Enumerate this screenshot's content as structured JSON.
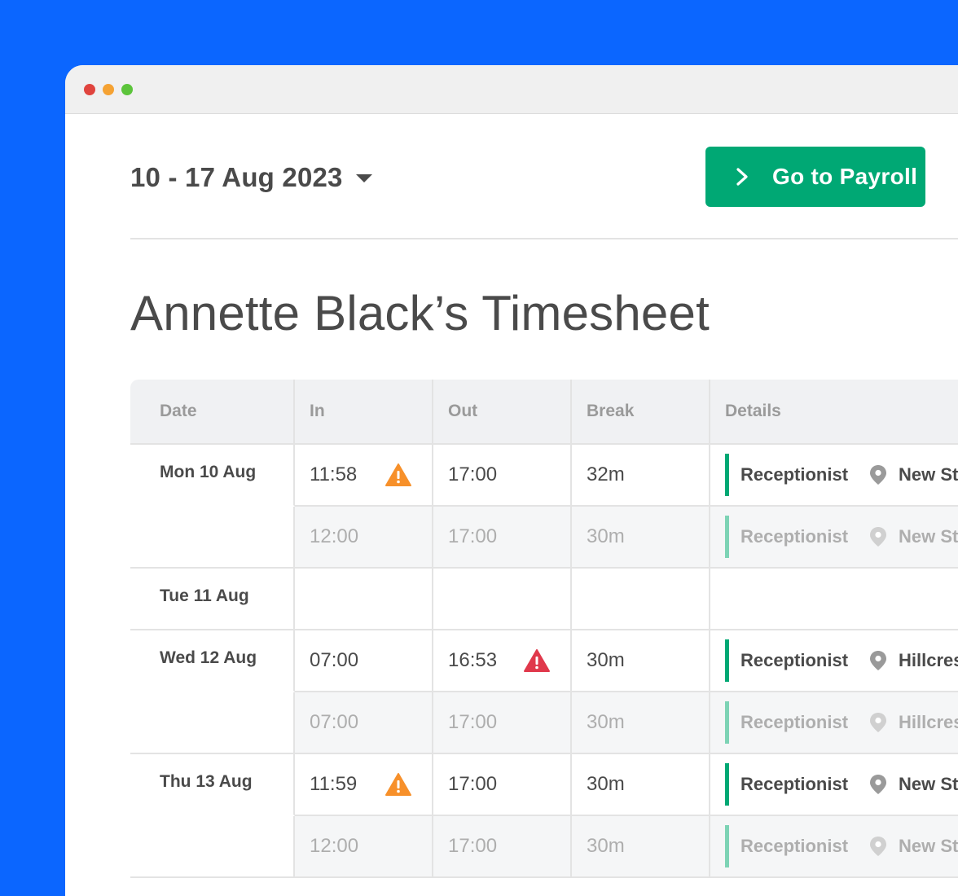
{
  "header": {
    "date_range": "10 - 17 Aug 2023",
    "payroll_button": "Go to Payroll"
  },
  "page_title": "Annette Black’s Timesheet",
  "table": {
    "columns": [
      "Date",
      "In",
      "Out",
      "Break",
      "Details"
    ],
    "days": [
      {
        "date": "Mon 10 Aug",
        "actual": {
          "in": "11:58",
          "out": "17:00",
          "break": "32m",
          "role": "Receptionist",
          "location": "New Str",
          "warning": "in",
          "warning_color": "#f7902a"
        },
        "scheduled": {
          "in": "12:00",
          "out": "17:00",
          "break": "30m",
          "role": "Receptionist",
          "location": "New Str"
        }
      },
      {
        "date": "Tue 11 Aug"
      },
      {
        "date": "Wed 12 Aug",
        "actual": {
          "in": "07:00",
          "out": "16:53",
          "break": "30m",
          "role": "Receptionist",
          "location": "Hillcrest",
          "warning": "out",
          "warning_color": "#e0384b"
        },
        "scheduled": {
          "in": "07:00",
          "out": "17:00",
          "break": "30m",
          "role": "Receptionist",
          "location": "Hillcrest"
        }
      },
      {
        "date": "Thu 13 Aug",
        "actual": {
          "in": "11:59",
          "out": "17:00",
          "break": "30m",
          "role": "Receptionist",
          "location": "New Str",
          "warning": "in",
          "warning_color": "#f7902a"
        },
        "scheduled": {
          "in": "12:00",
          "out": "17:00",
          "break": "30m",
          "role": "Receptionist",
          "location": "New Str"
        }
      }
    ]
  },
  "icons": {
    "date_dropdown": "caret-down-icon",
    "payroll": "chevron-right-icon",
    "warning": "warning-triangle-icon",
    "location": "map-pin-icon"
  },
  "colors": {
    "background": "#0b66ff",
    "accent": "#00a874",
    "accent_light": "#7dd3b5",
    "warning_orange": "#f7902a",
    "warning_red": "#e0384b"
  }
}
